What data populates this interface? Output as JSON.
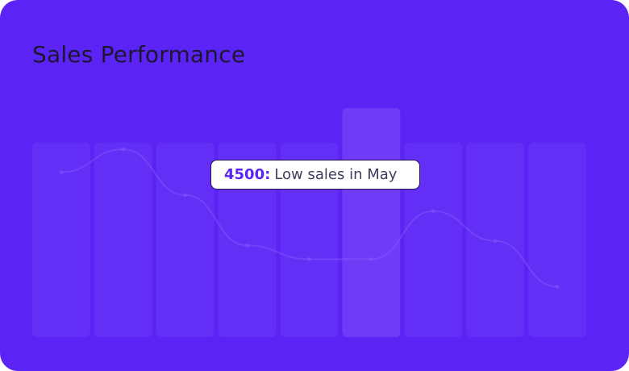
{
  "colors": {
    "card_background": "#5b24f4",
    "bar_fill": "#6a36f5",
    "bar_fill_highlight": "#7440f7",
    "title_text": "#1c1633",
    "tooltip_background": "#ffffff",
    "tooltip_border": "#241a46",
    "tooltip_value": "#5b24f4",
    "tooltip_text": "#433b5e"
  },
  "chart_data": {
    "type": "bar",
    "title": "Sales Performance",
    "categories": [
      "",
      "",
      "",
      "",
      "",
      "",
      "",
      "",
      ""
    ],
    "values": [
      85,
      85,
      85,
      85,
      85,
      100,
      85,
      85,
      85
    ],
    "highlight_index": 5,
    "trend_line": [
      72,
      82,
      62,
      40,
      34,
      34,
      55,
      42,
      22
    ],
    "grid": false,
    "tooltip": {
      "value": "4500",
      "separator": ":",
      "text": "Low sales in May"
    }
  }
}
